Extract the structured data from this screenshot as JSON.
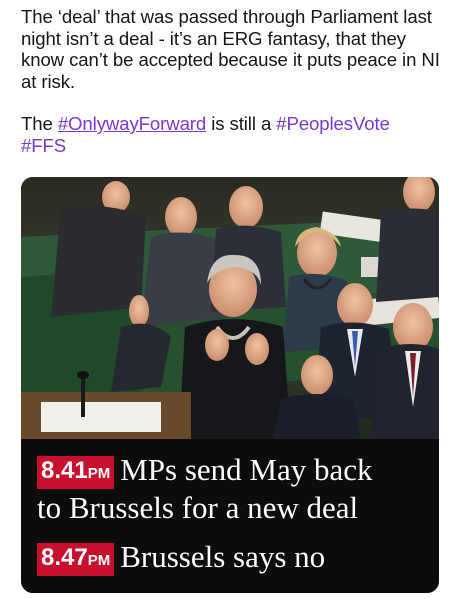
{
  "tweet": {
    "para1": "The ‘deal’ that was passed through Parliament last night isn’t a deal - it’s an ERG fantasy, that they know can’t be accepted because it puts peace in NI at risk.",
    "para2_prefix": "The ",
    "hashtag_1": "#OnlywayForward",
    "para2_middle": " is still a ",
    "hashtag_2": "#PeoplesVote",
    "hashtag_3": "#FFS"
  },
  "media": {
    "line1_time": "8.41",
    "line1_unit": "PM",
    "line1_text": "MPs send May back",
    "line2_text": "to Brussels for a new deal",
    "line3_time": "8.47",
    "line3_unit": "PM",
    "line3_text": "Brussels says no"
  },
  "colors": {
    "hashtag": "#7a39d6",
    "badge": "#c8102e",
    "caption_background": "#0c0c0c"
  }
}
